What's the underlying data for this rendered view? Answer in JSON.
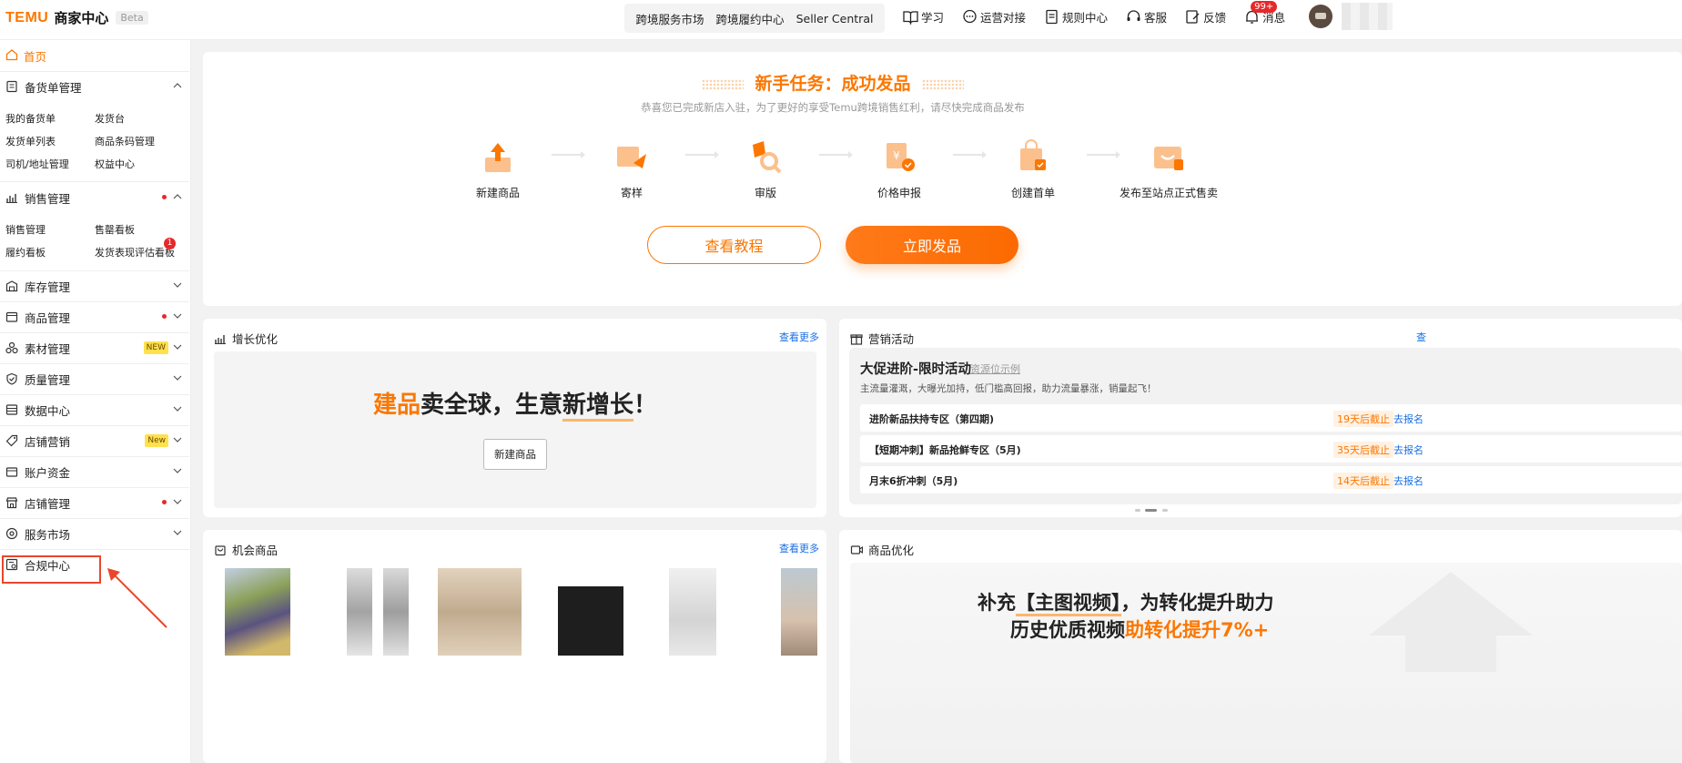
{
  "header": {
    "logo": "TEMU",
    "center_title": "商家中心",
    "beta": "Beta",
    "nav_box": [
      "跨境服务市场",
      "跨境履约中心",
      "Seller Central"
    ],
    "icons": [
      {
        "label": "学习",
        "icon": "book-icon"
      },
      {
        "label": "运营对接",
        "icon": "chat-icon"
      },
      {
        "label": "规则中心",
        "icon": "document-icon"
      },
      {
        "label": "客服",
        "icon": "headset-icon"
      },
      {
        "label": "反馈",
        "icon": "edit-icon"
      },
      {
        "label": "消息",
        "icon": "bell-icon",
        "badge": "99+"
      }
    ]
  },
  "sidebar": {
    "home": "首页",
    "groups": [
      {
        "label": "备货单管理",
        "expanded": true,
        "items": [
          "我的备货单",
          "发货台",
          "发货单列表",
          "商品条码管理",
          "司机/地址管理",
          "权益中心"
        ]
      },
      {
        "label": "销售管理",
        "expanded": true,
        "dot": true,
        "items": [
          "销售管理",
          "售罄看板",
          "履约看板",
          "发货表现评估看板"
        ],
        "item_badge": "1"
      },
      {
        "label": "库存管理"
      },
      {
        "label": "商品管理",
        "dot": true
      },
      {
        "label": "素材管理",
        "tag": "NEW"
      },
      {
        "label": "质量管理"
      },
      {
        "label": "数据中心"
      },
      {
        "label": "店铺营销",
        "tag": "New"
      },
      {
        "label": "账户资金"
      },
      {
        "label": "店铺管理",
        "dot": true
      },
      {
        "label": "服务市场"
      },
      {
        "label": "合规中心"
      }
    ]
  },
  "hero": {
    "title": "新手任务：成功发品",
    "subtitle": "恭喜您已完成新店入驻，为了更好的享受Temu跨境销售红利，请尽快完成商品发布",
    "steps": [
      "新建商品",
      "寄样",
      "审版",
      "价格申报",
      "创建首单",
      "发布至站点正式售卖"
    ],
    "btn_tutorial": "查看教程",
    "btn_publish": "立即发品"
  },
  "growth": {
    "title": "增长优化",
    "more": "查看更多",
    "slogan_a": "建品",
    "slogan_b": "卖全球，生意",
    "slogan_c": "新增长",
    "slogan_d": "！",
    "button": "新建商品"
  },
  "marketing": {
    "title": "营销活动",
    "more": "查",
    "banner_title": "大促进阶-限时活动",
    "resource": "资源位示例",
    "desc": "主流量灌溉，大曝光加持，低门槛高回报，助力流量暴涨，销量起飞！",
    "rows": [
      {
        "name": "进阶新品扶持专区（第四期)",
        "deadline": "19天后截止",
        "action": "去报名"
      },
      {
        "name": "【短期冲刺】新品抢鲜专区（5月)",
        "deadline": "35天后截止",
        "action": "去报名"
      },
      {
        "name": "月末6折冲刺（5月)",
        "deadline": "14天后截止",
        "action": "去报名"
      }
    ]
  },
  "opportunity": {
    "title": "机会商品",
    "more": "查看更多"
  },
  "product_opt": {
    "title": "商品优化",
    "line1_a": "补充",
    "line1_b": "【主图视频】",
    "line1_c": "，为转化提升助力",
    "line2_a": "历史优质视频",
    "line2_b": "助转化提升7%+"
  },
  "colors": {
    "brand": "#fb7701",
    "link": "#1a6fe3",
    "alert": "#e5292a"
  }
}
